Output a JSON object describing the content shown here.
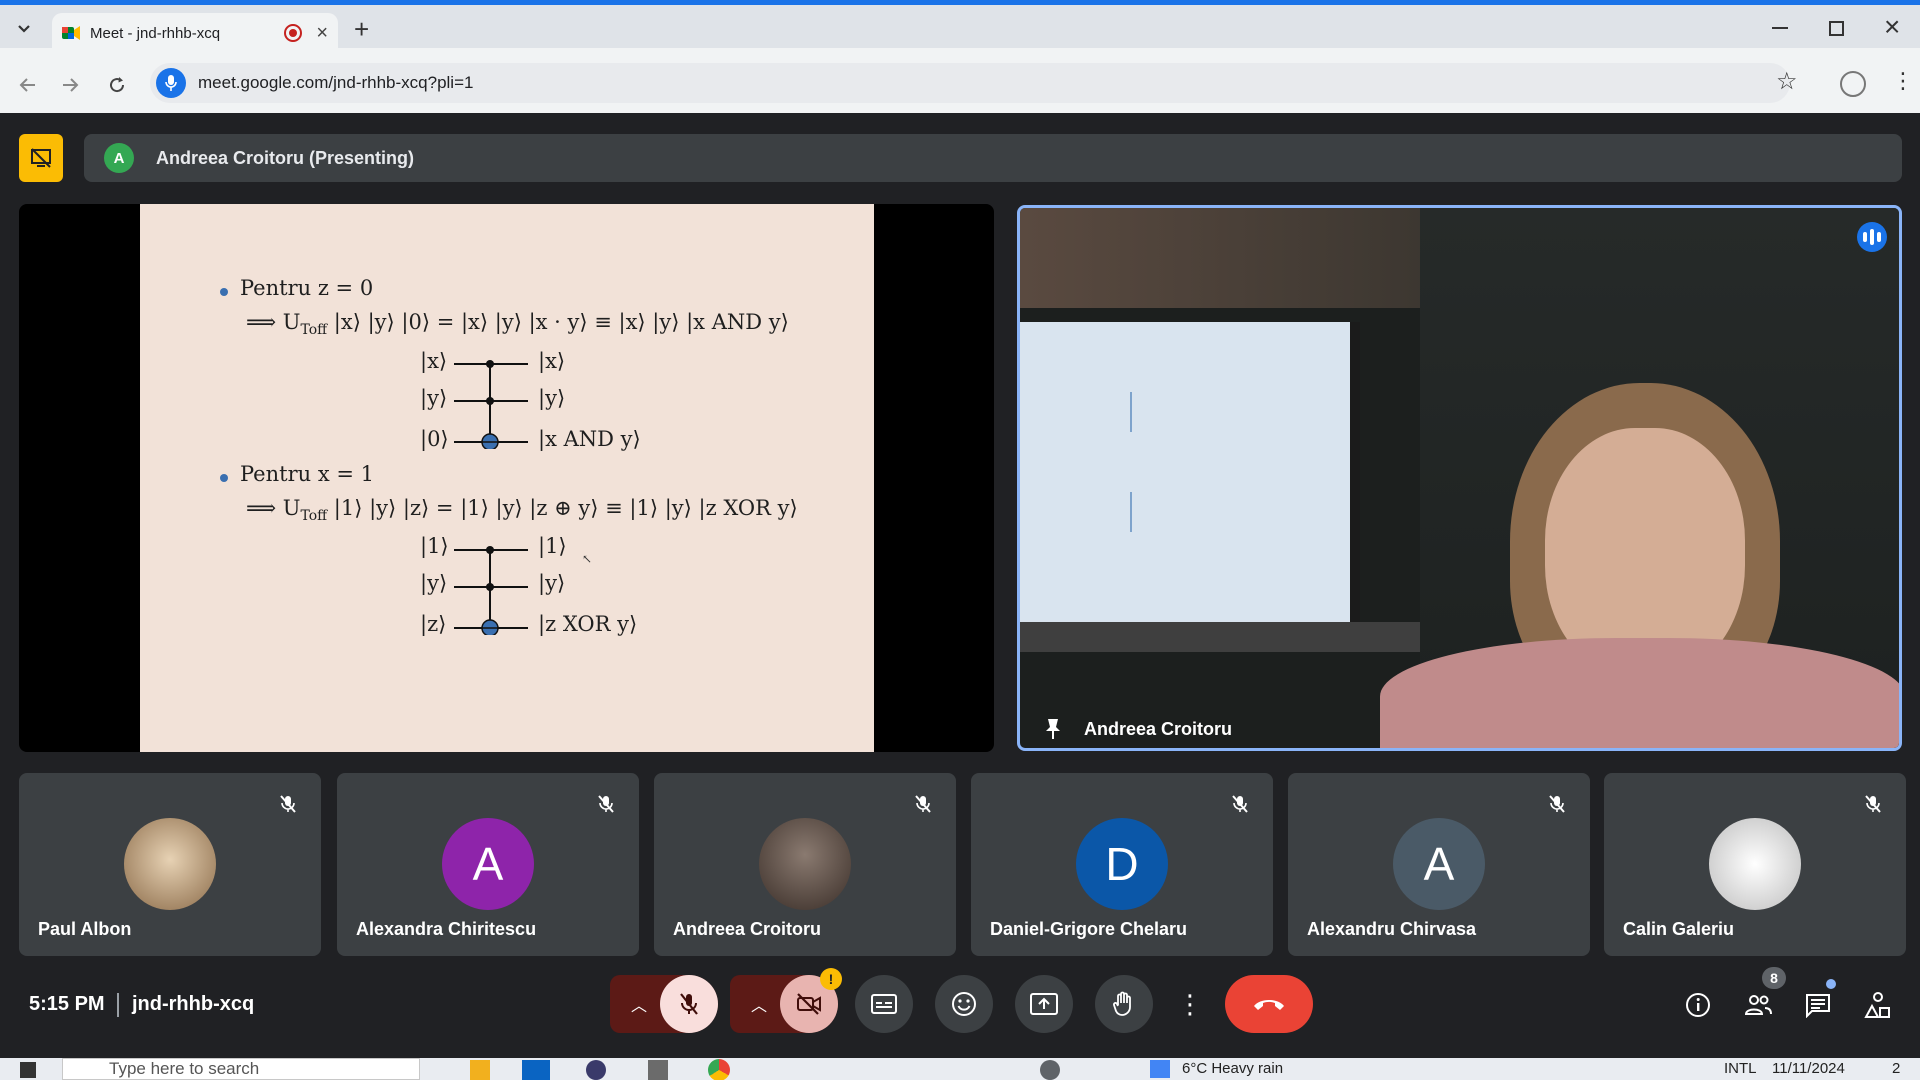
{
  "browser": {
    "tab_title": "Meet - jnd-rhhb-xcq",
    "url": "meet.google.com/jnd-rhhb-xcq?pli=1",
    "new_tab_label": "+"
  },
  "meet": {
    "presenting_avatar_letter": "A",
    "presenting_label": "Andreea Croitoru (Presenting)",
    "video_tile_name": "Andreea Croitoru",
    "slide": {
      "line1": "Pentru z = 0",
      "line2": "⟹  U",
      "line2_sub": "Toff",
      "line2_rest": " |x⟩ |y⟩ |0⟩ = |x⟩ |y⟩ |x · y⟩ ≡ |x⟩ |y⟩ |x AND y⟩",
      "c1_in1": "|x⟩",
      "c1_in2": "|y⟩",
      "c1_in3": "|0⟩",
      "c1_out1": "|x⟩",
      "c1_out2": "|y⟩",
      "c1_out3": "|x AND y⟩",
      "line3": "Pentru x = 1",
      "line4": "⟹  U",
      "line4_sub": "Toff",
      "line4_rest": " |1⟩ |y⟩ |z⟩ = |1⟩ |y⟩ |z ⊕ y⟩ ≡ |1⟩ |y⟩ |z XOR y⟩",
      "c2_in1": "|1⟩",
      "c2_in2": "|y⟩",
      "c2_in3": "|z⟩",
      "c2_out1": "|1⟩",
      "c2_out2": "|y⟩",
      "c2_out3": "|z XOR y⟩"
    },
    "participants": [
      {
        "name": "Paul Albon",
        "avatar": "",
        "color": "#c9a97c"
      },
      {
        "name": "Alexandra Chiritescu",
        "avatar": "A",
        "color": "#8e24aa"
      },
      {
        "name": "Andreea Croitoru",
        "avatar": "",
        "color": "#6b5a4e"
      },
      {
        "name": "Daniel-Grigore Chelaru",
        "avatar": "D",
        "color": "#0b57a8"
      },
      {
        "name": "Alexandru Chirvasa",
        "avatar": "A",
        "color": "#4a5a67"
      },
      {
        "name": "Calin Galeriu",
        "avatar": "",
        "color": "#e8e8e8"
      }
    ]
  },
  "controls": {
    "time": "5:15 PM",
    "meeting_code": "jnd-rhhb-xcq",
    "people_count": "8",
    "camera_warning": "!"
  },
  "taskbar": {
    "search_placeholder": "Type here to search",
    "weather": "6°C  Heavy rain",
    "lang": "INTL",
    "date": "11/11/2024",
    "notifications": "2"
  },
  "colors": {
    "accent": "#1a73e8",
    "end_call": "#ea4335",
    "mic_off_bg": "#f9dedc",
    "present_logo": "#fbbc04"
  }
}
